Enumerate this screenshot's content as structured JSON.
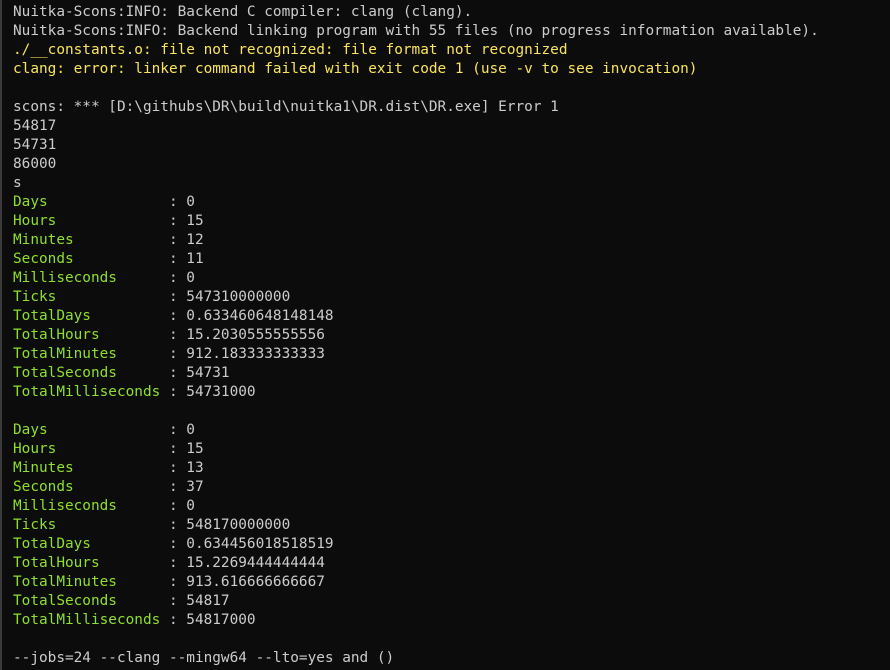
{
  "terminal": {
    "header_lines": [
      {
        "text": "Nuitka-Scons:INFO: Backend C compiler: clang (clang).",
        "style": "normal"
      },
      {
        "text": "Nuitka-Scons:INFO: Backend linking program with 55 files (no progress information available).",
        "style": "normal"
      },
      {
        "text": "./__constants.o: file not recognized: file format not recognized",
        "style": "warn"
      },
      {
        "text": "clang: error: linker command failed with exit code 1 (use -v to see invocation)",
        "style": "warn"
      },
      {
        "text": "",
        "style": "normal"
      },
      {
        "text": "scons: *** [D:\\githubs\\DR\\build\\nuitka1\\DR.dist\\DR.exe] Error 1",
        "style": "normal"
      },
      {
        "text": "54817",
        "style": "normal"
      },
      {
        "text": "54731",
        "style": "normal"
      },
      {
        "text": "86000",
        "style": "normal"
      },
      {
        "text": "s",
        "style": "normal"
      }
    ],
    "timespans": [
      [
        {
          "key": "Days",
          "value": "0"
        },
        {
          "key": "Hours",
          "value": "15"
        },
        {
          "key": "Minutes",
          "value": "12"
        },
        {
          "key": "Seconds",
          "value": "11"
        },
        {
          "key": "Milliseconds",
          "value": "0"
        },
        {
          "key": "Ticks",
          "value": "547310000000"
        },
        {
          "key": "TotalDays",
          "value": "0.633460648148148"
        },
        {
          "key": "TotalHours",
          "value": "15.2030555555556"
        },
        {
          "key": "TotalMinutes",
          "value": "912.183333333333"
        },
        {
          "key": "TotalSeconds",
          "value": "54731"
        },
        {
          "key": "TotalMilliseconds",
          "value": "54731000"
        }
      ],
      [
        {
          "key": "Days",
          "value": "0"
        },
        {
          "key": "Hours",
          "value": "15"
        },
        {
          "key": "Minutes",
          "value": "13"
        },
        {
          "key": "Seconds",
          "value": "37"
        },
        {
          "key": "Milliseconds",
          "value": "0"
        },
        {
          "key": "Ticks",
          "value": "548170000000"
        },
        {
          "key": "TotalDays",
          "value": "0.634456018518519"
        },
        {
          "key": "TotalHours",
          "value": "15.2269444444444"
        },
        {
          "key": "TotalMinutes",
          "value": "913.616666666667"
        },
        {
          "key": "TotalSeconds",
          "value": "54817"
        },
        {
          "key": "TotalMilliseconds",
          "value": "54817000"
        }
      ]
    ],
    "separator": " : ",
    "footer_line": "--jobs=24 --clang --mingw64 --lto=yes and ()",
    "colors": {
      "background": "#0c0c0c",
      "text": "#cccccc",
      "warning": "#f9e45b",
      "key": "#8fdf2e"
    }
  }
}
